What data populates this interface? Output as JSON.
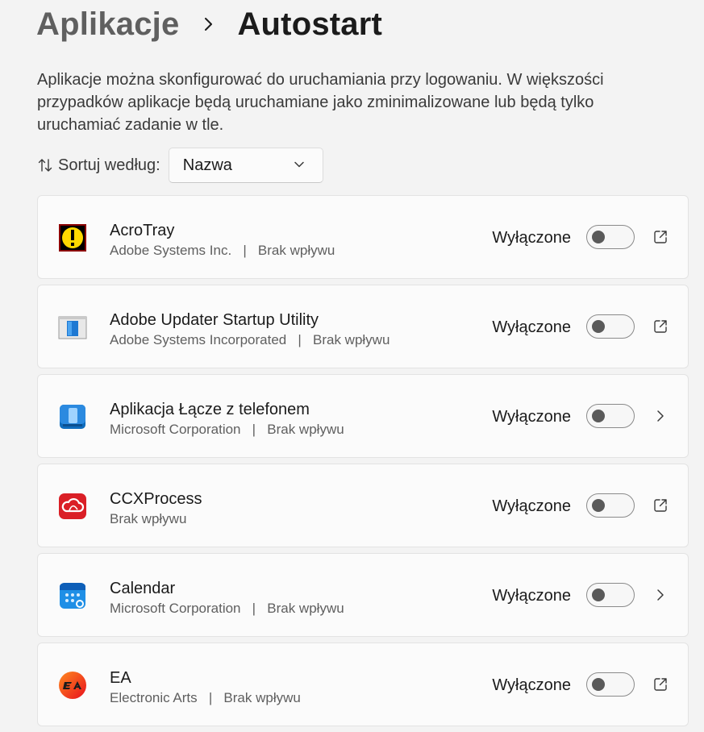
{
  "breadcrumb": {
    "parent": "Aplikacje",
    "current": "Autostart"
  },
  "description": "Aplikacje można skonfigurować do uruchamiania przy logowaniu. W większości przypadków aplikacje będą uruchamiane jako zminimalizowane lub będą tylko uruchamiać zadanie w tle.",
  "sort": {
    "label": "Sortuj według:",
    "selected": "Nazwa"
  },
  "apps": [
    {
      "name": "AcroTray",
      "subtitle": "Adobe Systems Inc.   |   Brak wpływu",
      "status": "Wyłączone",
      "enabled": false,
      "action_icon": "open-external-icon",
      "app_icon": "acrotray-icon"
    },
    {
      "name": "Adobe Updater Startup Utility",
      "subtitle": "Adobe Systems Incorporated   |   Brak wpływu",
      "status": "Wyłączone",
      "enabled": false,
      "action_icon": "open-external-icon",
      "app_icon": "adobe-updater-icon"
    },
    {
      "name": "Aplikacja Łącze z telefonem",
      "subtitle": "Microsoft Corporation   |   Brak wpływu",
      "status": "Wyłączone",
      "enabled": false,
      "action_icon": "chevron-right-icon",
      "app_icon": "phone-link-icon"
    },
    {
      "name": "CCXProcess",
      "subtitle": "Brak wpływu",
      "status": "Wyłączone",
      "enabled": false,
      "action_icon": "open-external-icon",
      "app_icon": "creative-cloud-icon"
    },
    {
      "name": "Calendar",
      "subtitle": "Microsoft Corporation   |   Brak wpływu",
      "status": "Wyłączone",
      "enabled": false,
      "action_icon": "chevron-right-icon",
      "app_icon": "calendar-icon"
    },
    {
      "name": "EA",
      "subtitle": "Electronic Arts   |   Brak wpływu",
      "status": "Wyłączone",
      "enabled": false,
      "action_icon": "open-external-icon",
      "app_icon": "ea-icon"
    }
  ],
  "colors": {
    "background": "#f3f3f3",
    "card": "#fbfbfb",
    "toggle_off_knob": "#5a5a5a"
  }
}
